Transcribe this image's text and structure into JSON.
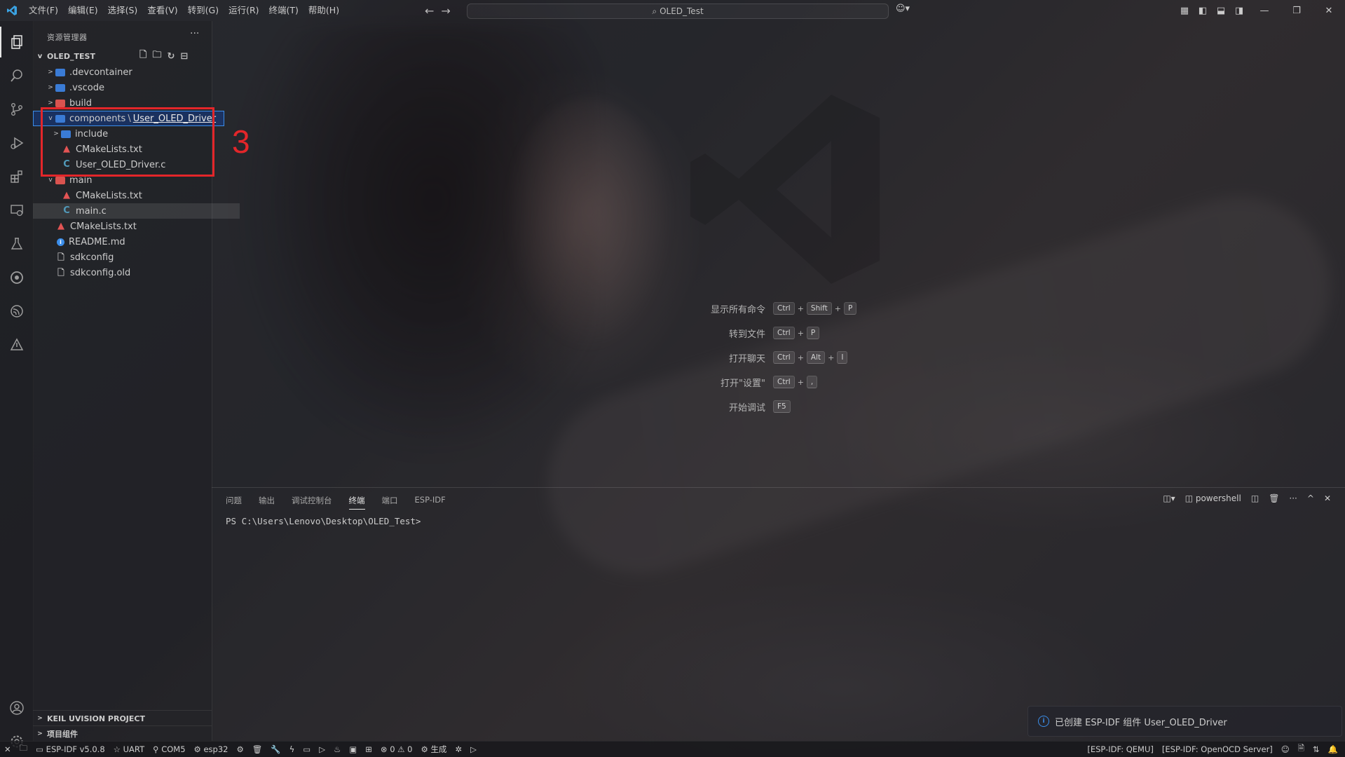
{
  "titlebar": {
    "menus": [
      "文件(F)",
      "编辑(E)",
      "选择(S)",
      "查看(V)",
      "转到(G)",
      "运行(R)",
      "终端(T)",
      "帮助(H)"
    ],
    "search_text": "OLED_Test"
  },
  "sidebar": {
    "title": "资源管理器",
    "project_name": "OLED_TEST",
    "tree": {
      "devcontainer": ".devcontainer",
      "vscode": ".vscode",
      "build": "build",
      "components": "components",
      "separator": "\\",
      "user_oled_driver": "User_OLED_Driver",
      "include": "include",
      "cmakelists_comp": "CMakeLists.txt",
      "user_oled_driver_c": "User_OLED_Driver.c",
      "main": "main",
      "cmakelists_main": "CMakeLists.txt",
      "main_c": "main.c",
      "cmakelists_root": "CMakeLists.txt",
      "readme": "README.md",
      "sdkconfig": "sdkconfig",
      "sdkconfig_old": "sdkconfig.old"
    },
    "bottom_sections": [
      "KEIL UVISION PROJECT",
      "项目组件"
    ]
  },
  "annotation": {
    "step": "3"
  },
  "shortcuts": [
    {
      "label": "显示所有命令",
      "keys": [
        "Ctrl",
        "Shift",
        "P"
      ]
    },
    {
      "label": "转到文件",
      "keys": [
        "Ctrl",
        "P"
      ]
    },
    {
      "label": "打开聊天",
      "keys": [
        "Ctrl",
        "Alt",
        "I"
      ]
    },
    {
      "label": "打开\"设置\"",
      "keys": [
        "Ctrl",
        ","
      ]
    },
    {
      "label": "开始调试",
      "keys": [
        "F5"
      ]
    }
  ],
  "panel": {
    "tabs": [
      "问题",
      "输出",
      "调试控制台",
      "终端",
      "端口",
      "ESP-IDF"
    ],
    "active_tab": "终端",
    "shell": "powershell",
    "terminal_prompt": "PS C:\\Users\\Lenovo\\Desktop\\OLED_Test>"
  },
  "notification": {
    "text": "已创建 ESP-IDF 组件 User_OLED_Driver"
  },
  "statusbar": {
    "idf_version": "ESP-IDF v5.0.8",
    "uart": "UART",
    "port": "COM5",
    "target": "esp32",
    "problems": "0",
    "warnings": "0",
    "build": "生成",
    "qemu": "[ESP-IDF: QEMU]",
    "openocd": "[ESP-IDF: OpenOCD Server]"
  },
  "colors": {
    "accent": "#3b8eea",
    "annotation_red": "#e3262a"
  }
}
